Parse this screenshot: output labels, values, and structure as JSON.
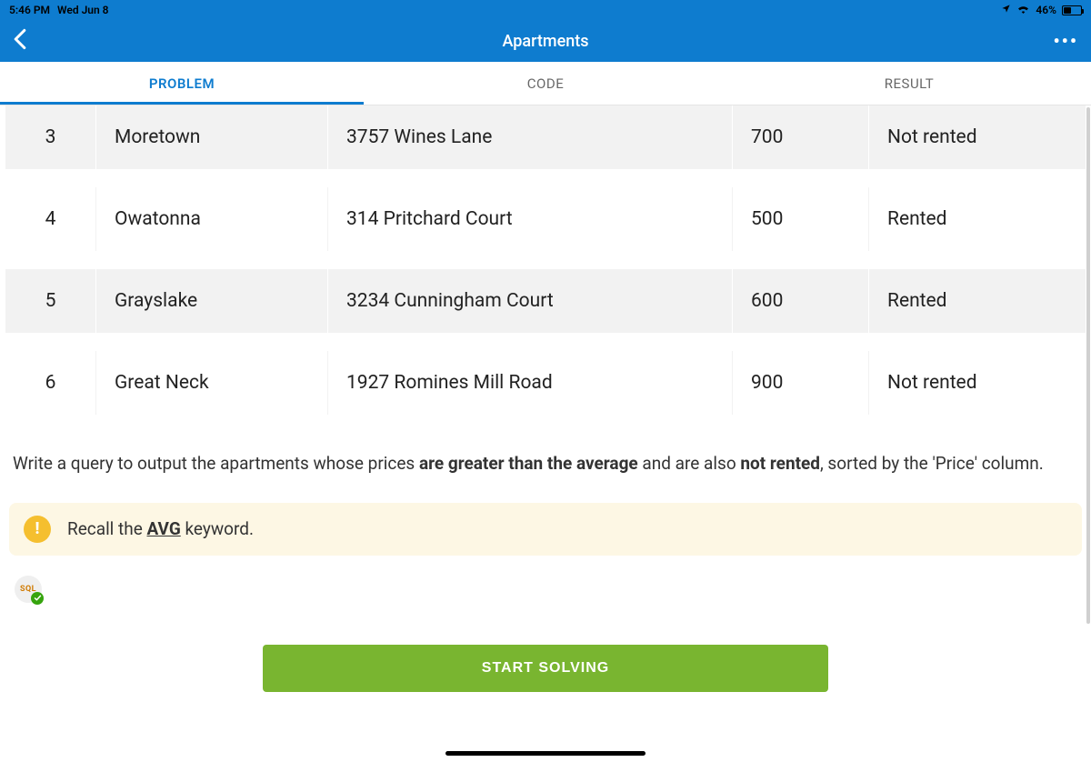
{
  "status": {
    "time": "5:46 PM",
    "date": "Wed Jun 8",
    "battery_pct": "46%",
    "battery_fill_pct": 46
  },
  "nav": {
    "title": "Apartments"
  },
  "tabs": {
    "problem": "PROBLEM",
    "code": "CODE",
    "result": "RESULT",
    "active": "problem"
  },
  "rows": [
    {
      "id": "3",
      "city": "Moretown",
      "address": "3757 Wines Lane",
      "price": "700",
      "status": "Not rented"
    },
    {
      "id": "4",
      "city": "Owatonna",
      "address": "314 Pritchard Court",
      "price": "500",
      "status": "Rented"
    },
    {
      "id": "5",
      "city": "Grayslake",
      "address": "3234 Cunningham Court",
      "price": "600",
      "status": "Rented"
    },
    {
      "id": "6",
      "city": "Great Neck",
      "address": "1927 Romines Mill Road",
      "price": "900",
      "status": "Not rented"
    }
  ],
  "instruction": {
    "pre": "Write a query to output the apartments whose prices ",
    "bold1": "are greater than the average",
    "mid": " and are also ",
    "bold2": "not rented",
    "post": ", sorted by the 'Price' column."
  },
  "hint": {
    "pre": "Recall the ",
    "kw": "AVG",
    "post": " keyword."
  },
  "badge": {
    "label": "SQL"
  },
  "actions": {
    "start": "START SOLVING"
  }
}
